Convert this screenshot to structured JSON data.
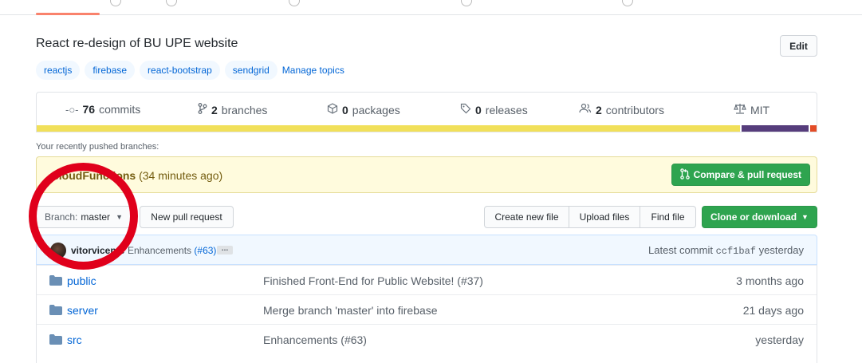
{
  "repo": {
    "description": "React re-design of BU UPE website",
    "edit_label": "Edit",
    "topics": [
      "reactjs",
      "firebase",
      "react-bootstrap",
      "sendgrid"
    ],
    "manage_topics": "Manage topics"
  },
  "summary": {
    "commits": {
      "count": "76",
      "label": "commits"
    },
    "branches": {
      "count": "2",
      "label": "branches"
    },
    "packages": {
      "count": "0",
      "label": "packages"
    },
    "releases": {
      "count": "0",
      "label": "releases"
    },
    "contributors": {
      "count": "2",
      "label": "contributors"
    },
    "license": "MIT"
  },
  "languages": [
    {
      "color": "#f1e05a",
      "percent": 90.6
    },
    {
      "color": "#563d7c",
      "percent": 8.6
    },
    {
      "color": "#e34c26",
      "percent": 0.8
    }
  ],
  "recent": {
    "label": "Your recently pushed branches:",
    "branch": "cloudFunctions",
    "time": "(34 minutes ago)",
    "compare_label": "Compare & pull request"
  },
  "toolbar": {
    "branch_prefix": "Branch:",
    "branch_name": "master",
    "new_pr": "New pull request",
    "create_file": "Create new file",
    "upload_files": "Upload files",
    "find_file": "Find file",
    "clone": "Clone or download"
  },
  "commit": {
    "author": "vitorvicente",
    "message": "Enhancements",
    "pr": "(#63)",
    "dots": "…",
    "latest_prefix": "Latest commit",
    "sha": "ccf1baf",
    "when": "yesterday"
  },
  "files": [
    {
      "name": "public",
      "message": "Finished Front-End for Public Website! (#37)",
      "age": "3 months ago"
    },
    {
      "name": "server",
      "message": "Merge branch 'master' into firebase",
      "age": "21 days ago"
    },
    {
      "name": "src",
      "message": "Enhancements (#63)",
      "age": "yesterday"
    }
  ],
  "colors": {
    "accent_green": "#2ea44f",
    "link_blue": "#0366d6",
    "annotation_red": "#e0001b"
  }
}
